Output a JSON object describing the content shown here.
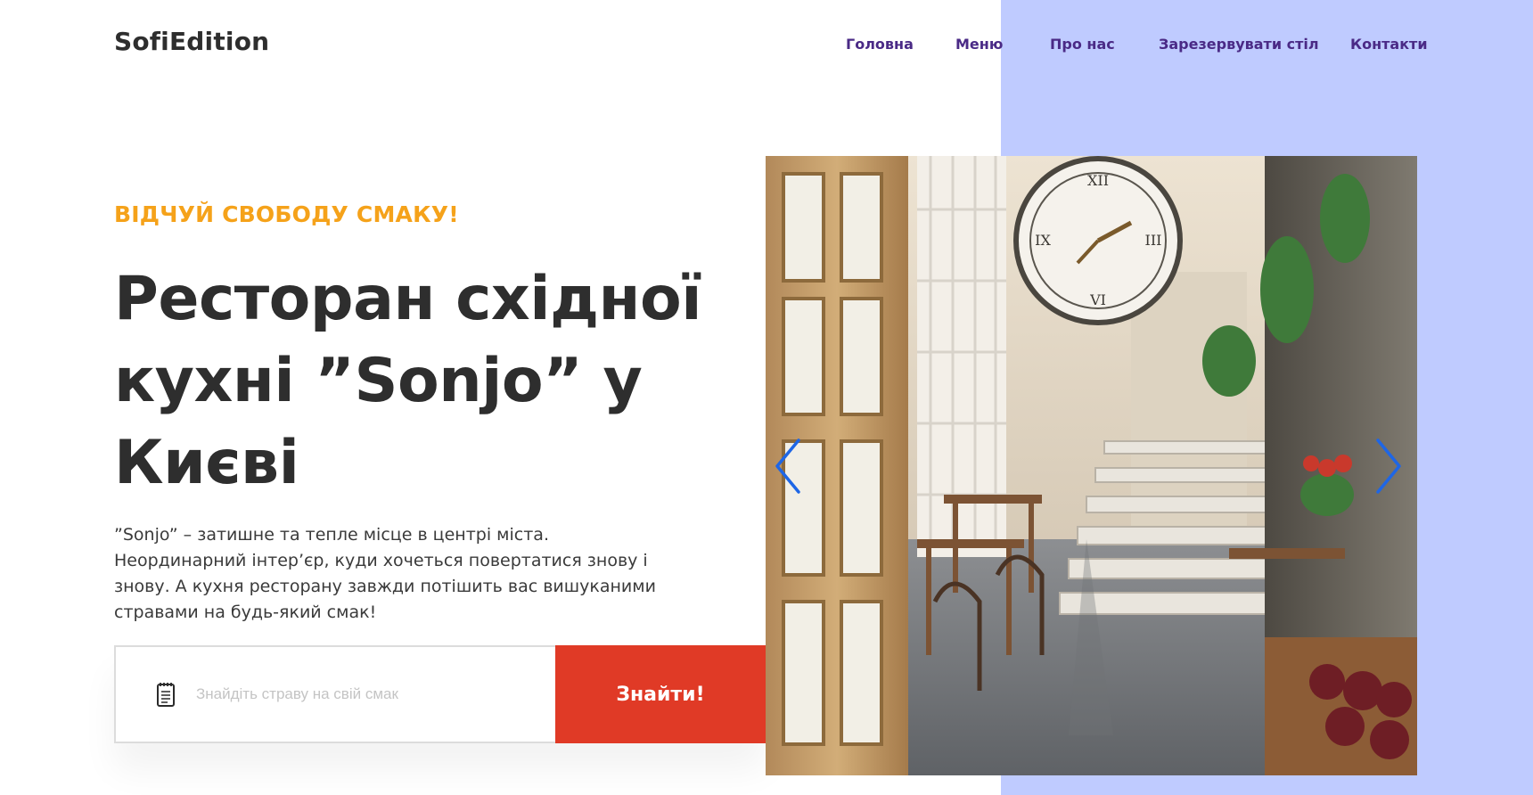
{
  "brand": {
    "logo_text": "SofiEdition"
  },
  "nav": {
    "items": [
      {
        "label": "Головна"
      },
      {
        "label": "Меню"
      },
      {
        "label": "Про нас"
      },
      {
        "label": "Зарезервувати стіл"
      },
      {
        "label": "Контакти"
      }
    ]
  },
  "hero": {
    "tagline": "ВІДЧУЙ СВОБОДУ СМАКУ!",
    "title": "Ресторан східної кухні ”Sonjo” у Києві",
    "description": "”Sonjo” – затишне та тепле місце в центрі міста. Неординарний інтер’єр, куди хочеться повертатися знову і знову. А кухня ресторану завжди потішить вас вишуканими стравами на будь-який смак!"
  },
  "search": {
    "placeholder": "Знайдіть страву на свій смак",
    "value": "",
    "button_label": "Знайти!",
    "icon": "notepad-icon"
  },
  "slider": {
    "prev_icon": "chevron-left-icon",
    "next_icon": "chevron-right-icon"
  },
  "colors": {
    "panel": "#bfcbff",
    "nav": "#4a2a86",
    "tagline": "#f5a21a",
    "button": "#e03a26",
    "arrows": "#1e66e6"
  }
}
